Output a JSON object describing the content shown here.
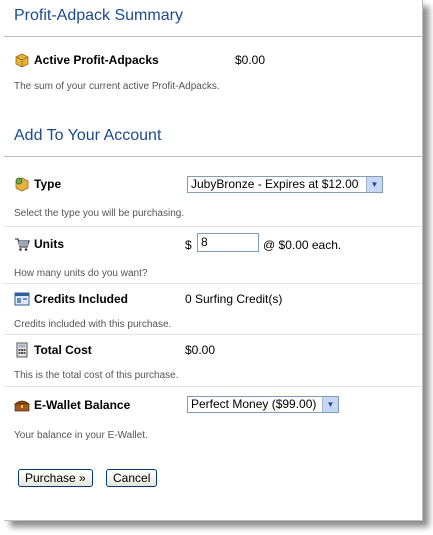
{
  "summary": {
    "title": "Profit-Adpack Summary",
    "active_label": "Active Profit-Adpacks",
    "active_value": "$0.00",
    "active_help": "The sum of your current active Profit-Adpacks."
  },
  "add": {
    "title": "Add To Your Account",
    "type": {
      "label": "Type",
      "selected": "JubyBronze - Expires at $12.00",
      "help": "Select the type you will be purchasing."
    },
    "units": {
      "label": "Units",
      "currency": "$",
      "value": "8",
      "suffix": "@ $0.00 each.",
      "help": "How many units do you want?"
    },
    "credits": {
      "label": "Credits Included",
      "value": "0 Surfing Credit(s)",
      "help": "Credits included with this purchase."
    },
    "total": {
      "label": "Total Cost",
      "value": "$0.00",
      "help": "This is the total cost of this purchase."
    },
    "wallet": {
      "label": "E-Wallet Balance",
      "selected": "Perfect Money ($99.00)",
      "help": "Your balance in your E-Wallet."
    },
    "buttons": {
      "purchase": "Purchase »",
      "cancel": "Cancel"
    }
  },
  "colors": {
    "title_blue": "#1c4a8f",
    "divider": "#bdbdbd"
  },
  "icons": {
    "active": "package-icon",
    "type": "package-gear-icon",
    "units": "shopping-cart-icon",
    "credits": "credits-window-icon",
    "total": "calculator-icon",
    "wallet": "treasure-chest-icon"
  }
}
